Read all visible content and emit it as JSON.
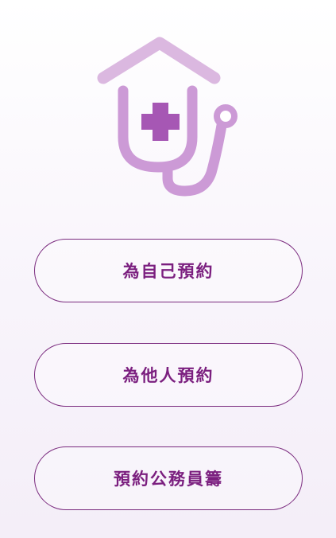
{
  "logo": {
    "icon": "house-stethoscope-cross-icon",
    "colors": {
      "light": "#d9b4df",
      "mid": "#c58fd0",
      "cross": "#a557b3"
    }
  },
  "buttons": {
    "self_label": "為自己預約",
    "others_label": "為他人預約",
    "civil_servant_label": "預約公務員籌"
  },
  "colors": {
    "accent": "#7b1f7f",
    "border": "#7a2a7e"
  }
}
